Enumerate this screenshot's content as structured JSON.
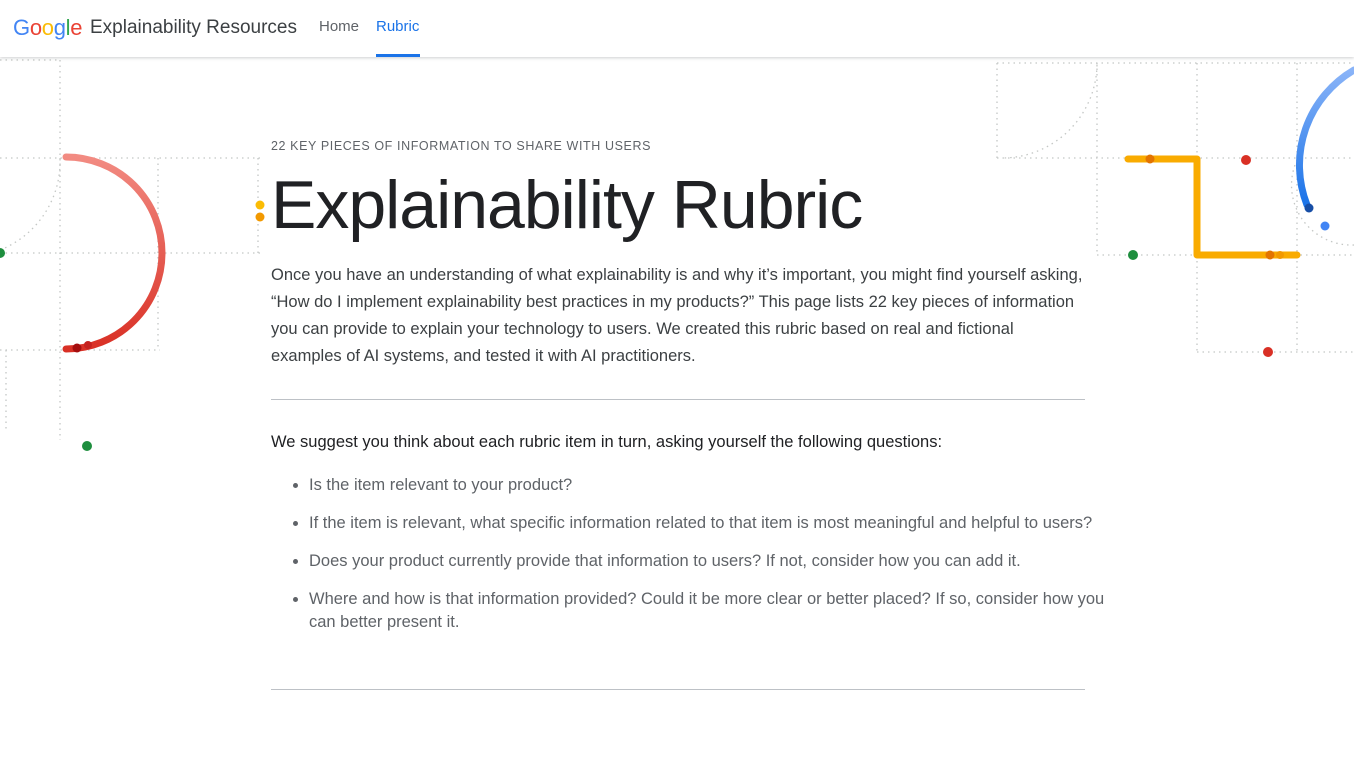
{
  "header": {
    "logo_text": "Google",
    "site_title": "Explainability Resources",
    "nav": [
      {
        "label": "Home",
        "active": false
      },
      {
        "label": "Rubric",
        "active": true
      }
    ]
  },
  "main": {
    "eyebrow": "22 KEY PIECES OF INFORMATION TO SHARE WITH USERS",
    "title": "Explainability Rubric",
    "intro": "Once you have an understanding of what explainability is and why it’s important, you might find yourself asking, “How do I implement explainability best practices in my products?” This page lists 22 key pieces of information you can provide to explain your technology to users. We created this rubric based on real and fictional examples of AI systems, and tested it with AI practitioners.",
    "suggest_heading": "We suggest you think about each rubric item in turn, asking yourself the following questions:",
    "questions": [
      "Is the item relevant to your product?",
      "If the item is relevant, what specific information related to that item is most meaningful and helpful to users?",
      "Does your product currently provide that information to users? If not, consider how you can add it.",
      "Where and how is that information provided? Could it be more clear or better placed? If so, consider how you can better present it."
    ]
  },
  "colors": {
    "accent": "#1a73e8",
    "red": "#ea4335",
    "yellow": "#f9ab00",
    "green": "#34a853",
    "blue": "#4285f4"
  }
}
